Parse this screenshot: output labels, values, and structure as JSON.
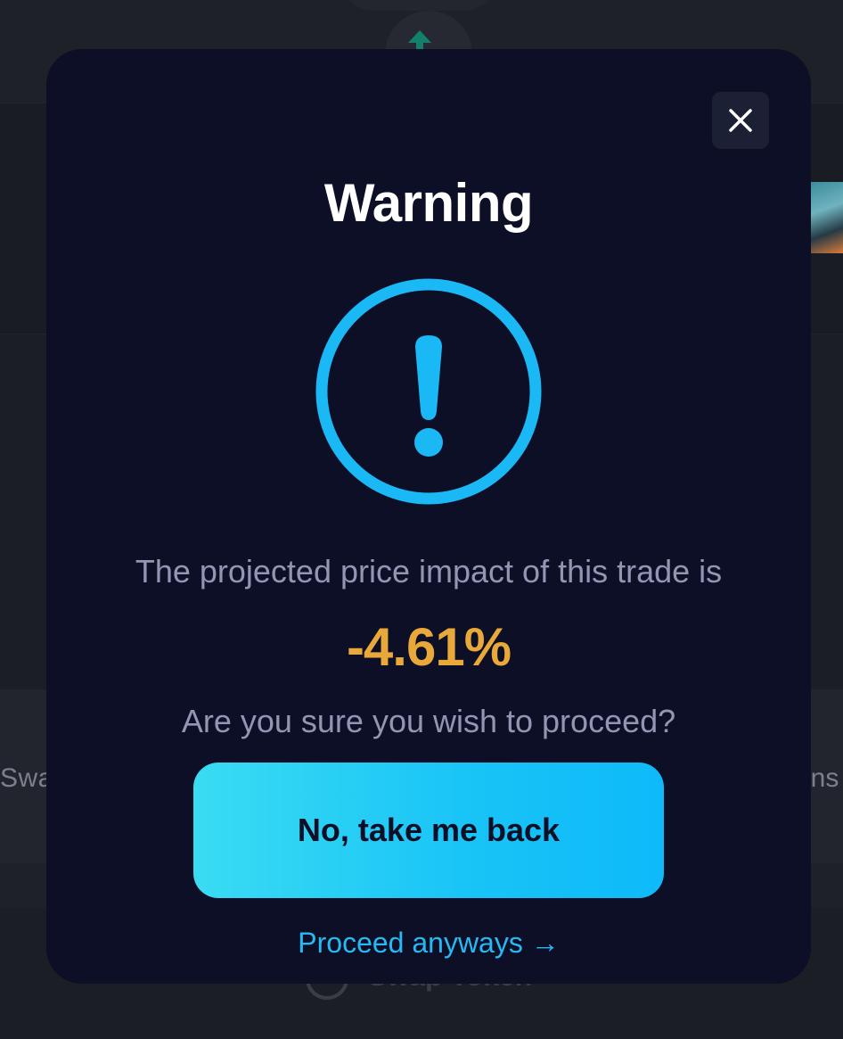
{
  "background": {
    "left_side_label": "Swa",
    "right_side_label": "ans",
    "bottom_label": "Swap Token"
  },
  "modal": {
    "close_icon": "close-icon",
    "title": "Warning",
    "warning_icon": "exclamation-circle-icon",
    "impact_text": "The projected price impact of this trade is",
    "impact_value": "-4.61%",
    "confirm_text": "Are you sure you wish to proceed?",
    "back_button_label": "No, take me back",
    "proceed_link_label": "Proceed anyways →"
  },
  "colors": {
    "modal_background": "#0c0f25",
    "accent": "#1ab8f5",
    "impact_value": "#e9a93a",
    "muted_text": "#9396b3"
  }
}
